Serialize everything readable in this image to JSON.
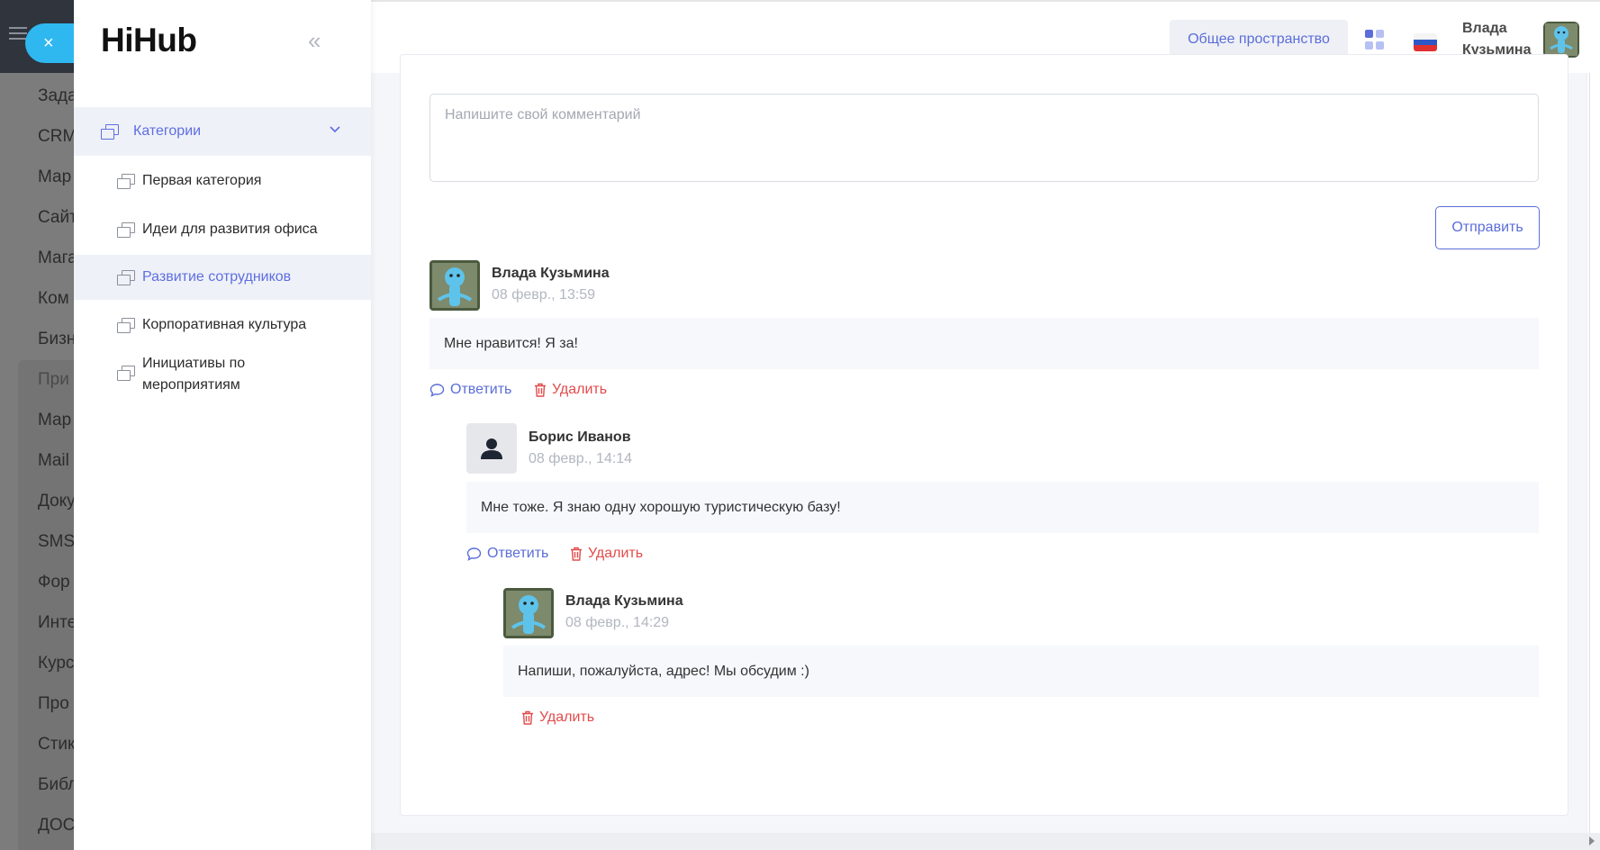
{
  "background_app": {
    "items": [
      "Зада",
      "CRM",
      "Мар",
      "Сайт",
      "Мага",
      "Ком",
      "Бизн",
      "При",
      "Мар",
      "Mail",
      "Доку",
      "SMS",
      "Фор",
      "Инте",
      "Курс",
      "Про",
      "Стик",
      "Библ",
      "ДОС"
    ]
  },
  "close_button": {
    "icon": "close-icon",
    "label": "×"
  },
  "drawer": {
    "logo": "HiHub",
    "collapse_icon": "«",
    "category_header": {
      "label": "Категории",
      "chevron": "⌄"
    },
    "categories": [
      {
        "label": "Первая категория",
        "active": false
      },
      {
        "label": "Идеи для развития офиса",
        "active": false
      },
      {
        "label": "Развитие сотрудников",
        "active": true
      },
      {
        "label": "Корпоративная культура",
        "active": false
      },
      {
        "label": "Инициативы по мероприятиям",
        "active": false
      }
    ]
  },
  "header": {
    "workspace_button": "Общее пространство",
    "apps_icon": "grid-icon",
    "language_flag": "ru-flag-icon",
    "user_name": "Влада Кузьмина"
  },
  "comment_form": {
    "placeholder": "Напишите свой комментарий",
    "submit_label": "Отправить"
  },
  "comments": [
    {
      "author": "Влада Кузьмина",
      "date": "08 февр., 13:59",
      "text": "Мне нравится! Я за!",
      "reply_label": "Ответить",
      "delete_label": "Удалить"
    },
    {
      "author": "Борис Иванов",
      "date": "08 февр., 14:14",
      "text": "Мне тоже. Я знаю одну хорошую туристическую базу!",
      "reply_label": "Ответить",
      "delete_label": "Удалить"
    },
    {
      "author": "Влада Кузьмина",
      "date": "08 февр., 14:29",
      "text": "Напиши, пожалуйста, адрес! Мы обсудим :)",
      "delete_label": "Удалить"
    }
  ],
  "colors": {
    "accent": "#5b6dd8",
    "danger": "#e24b4b",
    "active_bg": "#eef1f7",
    "fab": "#2fb8f0"
  }
}
